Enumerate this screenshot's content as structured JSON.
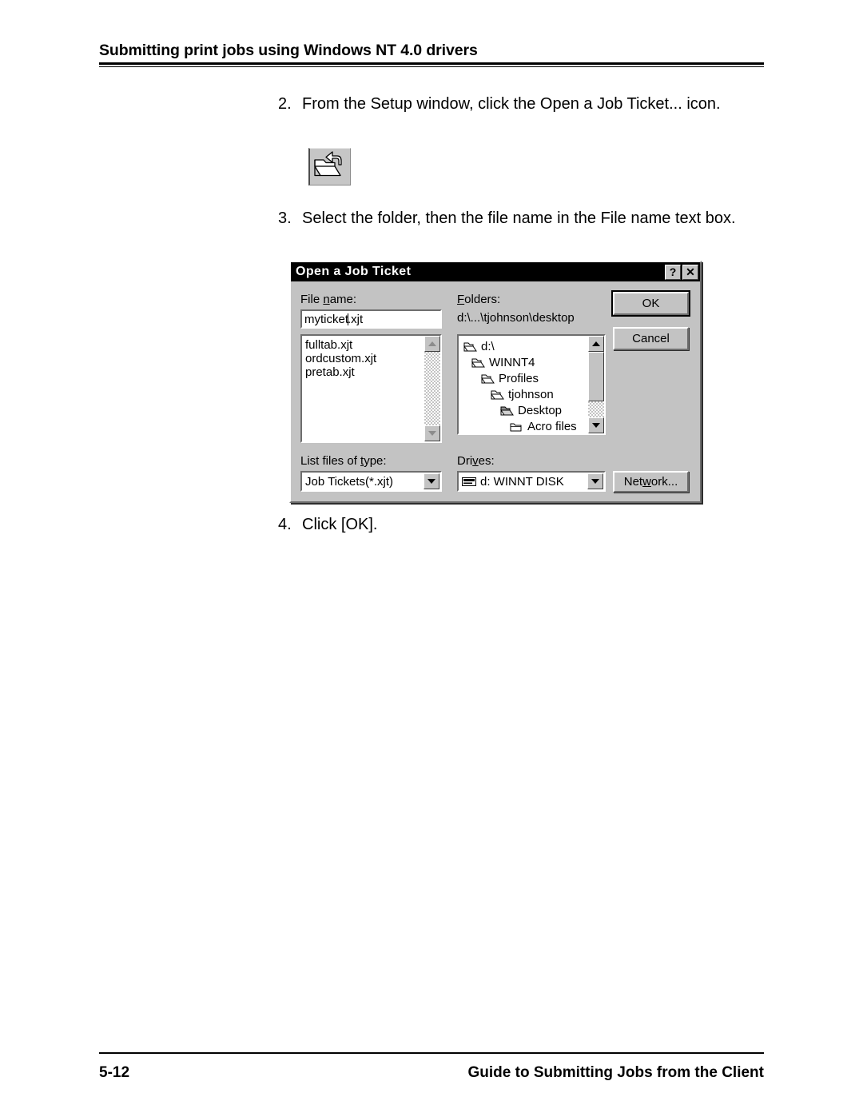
{
  "page": {
    "header_title": "Submitting print jobs using Windows NT 4.0 drivers",
    "footer_page_number": "5-12",
    "footer_title": "Guide to Submitting Jobs from the Client"
  },
  "steps": [
    {
      "num": "2.",
      "text": "From the Setup window, click the Open a Job Ticket... icon."
    },
    {
      "num": "3.",
      "text": "Select the folder, then the file name in the File name text box."
    },
    {
      "num": "4.",
      "text": "Click [OK]."
    }
  ],
  "toolbar_icon": {
    "name": "open-job-ticket-icon"
  },
  "dialog": {
    "title": "Open a Job Ticket",
    "titlebar_buttons": [
      {
        "name": "help-button",
        "glyph": "?"
      },
      {
        "name": "close-button",
        "glyph": "✕"
      }
    ],
    "file_name": {
      "label_pre": "File ",
      "label_accel": "n",
      "label_post": "ame:",
      "value_before_caret": "myticket",
      "value_after_caret": ".xjt",
      "full_value": "myticket.xjt"
    },
    "file_list": {
      "items": [
        "fulltab.xjt",
        "ordcustom.xjt",
        "pretab.xjt"
      ],
      "scrollbar_enabled": false
    },
    "folders": {
      "label_accel": "F",
      "label_post": "olders:",
      "path": "d:\\...\\tjohnson\\desktop",
      "tree": [
        {
          "label": "d:\\",
          "indent": 0,
          "icon": "folder-open-icon"
        },
        {
          "label": "WINNT4",
          "indent": 1,
          "icon": "folder-open-icon"
        },
        {
          "label": "Profiles",
          "indent": 2,
          "icon": "folder-open-icon"
        },
        {
          "label": "tjohnson",
          "indent": 3,
          "icon": "folder-open-icon"
        },
        {
          "label": "Desktop",
          "indent": 4,
          "icon": "folder-current-icon"
        },
        {
          "label": "Acro files",
          "indent": 5,
          "icon": "folder-closed-icon"
        }
      ]
    },
    "list_files_of_type": {
      "label_pre": "List files of ",
      "label_accel": "t",
      "label_post": "ype:",
      "value": "Job Tickets(*.xjt)"
    },
    "drives": {
      "label_pre": "Dri",
      "label_accel": "v",
      "label_post": "es:",
      "value": "d: WINNT DISK",
      "icon": "hard-disk-icon"
    },
    "buttons": {
      "ok": "OK",
      "cancel": "Cancel",
      "network_pre": "Net",
      "network_accel": "w",
      "network_post": "ork..."
    }
  },
  "colors": {
    "dialog_face": "#c3c3c3",
    "titlebar": "#000000",
    "field_bg": "#ffffff",
    "text": "#000000"
  }
}
